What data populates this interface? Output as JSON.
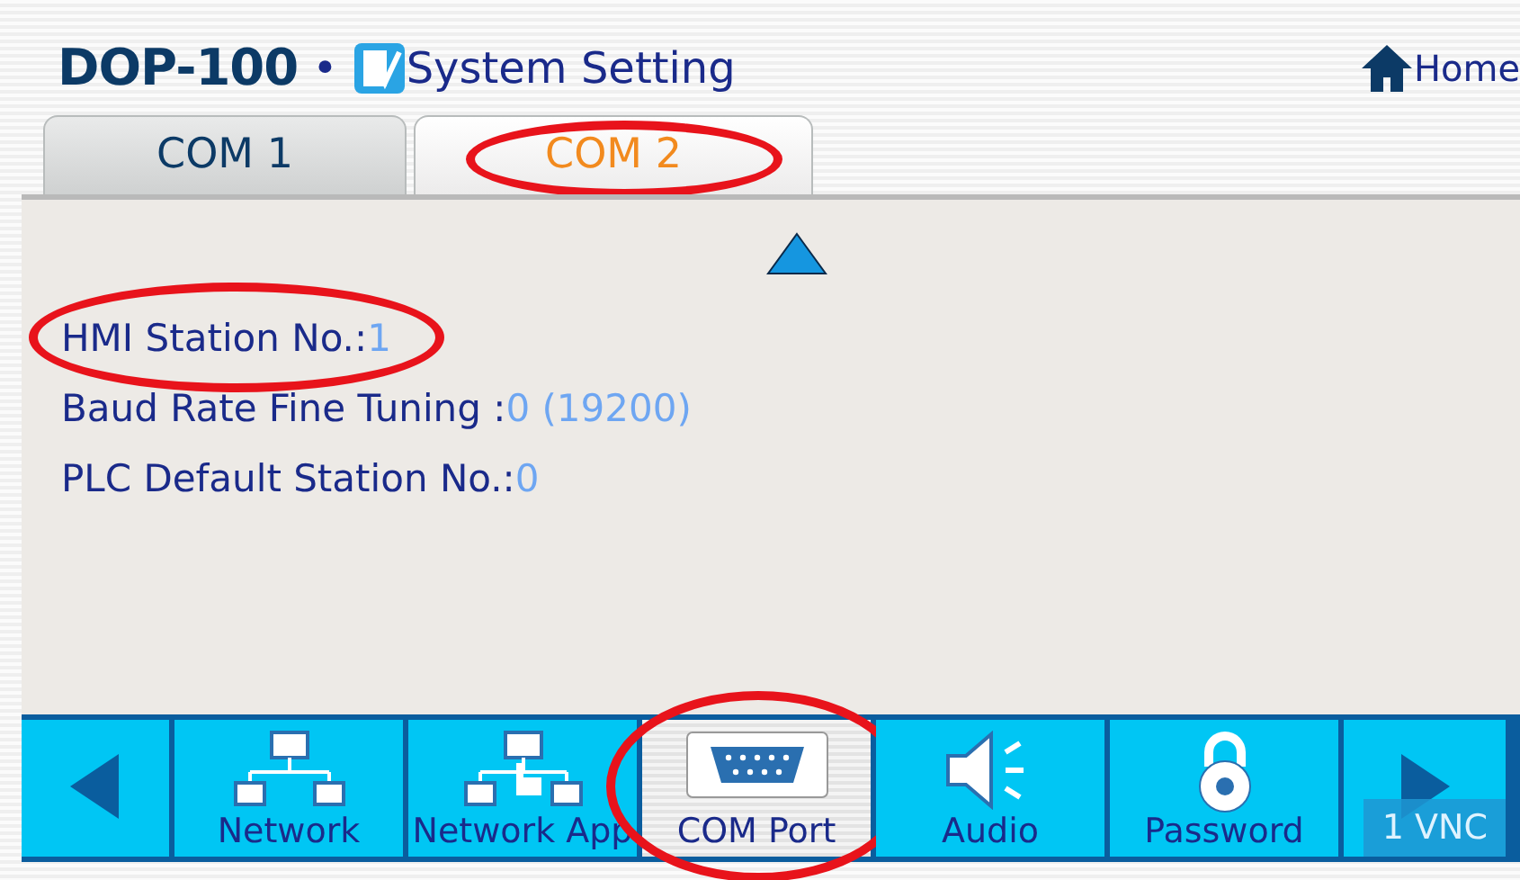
{
  "header": {
    "model": "DOP-100",
    "separator": "•",
    "title": "System Setting",
    "home": "Home"
  },
  "tabs": [
    {
      "label": "COM 1",
      "selected": false,
      "circled": false
    },
    {
      "label": "COM 2",
      "selected": true,
      "circled": true
    }
  ],
  "fields": [
    {
      "label": "HMI Station No.:",
      "value": "1",
      "circled": true
    },
    {
      "label": "Baud Rate Fine Tuning :",
      "value": "0 (19200)",
      "circled": false
    },
    {
      "label": "PLC Default Station No.:",
      "value": "0",
      "circled": false
    }
  ],
  "toolbar": [
    {
      "kind": "prev"
    },
    {
      "kind": "network",
      "label": "Network",
      "selected": false,
      "circled": false
    },
    {
      "kind": "network_app",
      "label": "Network App",
      "selected": false,
      "circled": false
    },
    {
      "kind": "com_port",
      "label": "COM Port",
      "selected": true,
      "circled": true
    },
    {
      "kind": "audio",
      "label": "Audio",
      "selected": false,
      "circled": false
    },
    {
      "kind": "password",
      "label": "Password",
      "selected": false,
      "circled": false
    },
    {
      "kind": "next"
    }
  ],
  "vnc_badge": "1 VNC"
}
